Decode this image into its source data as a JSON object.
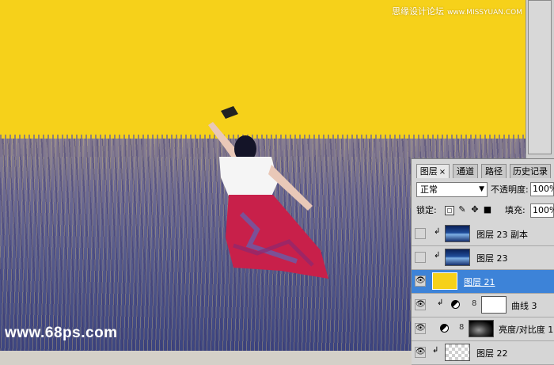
{
  "watermark_top": {
    "text": "思缘设计论坛",
    "site": "www.MISSYUAN.COM"
  },
  "watermark_bottom": "www.68ps.com",
  "colors": {
    "sky": "#f6d11a",
    "selection": "#3d83d8",
    "panel_bg": "#d6d6d6"
  },
  "panel": {
    "tabs": [
      {
        "label": "图层",
        "close": "×"
      },
      {
        "label": "通道"
      },
      {
        "label": "路径"
      },
      {
        "label": "历史记录"
      }
    ],
    "blend_mode": "正常",
    "opacity_label": "不透明度:",
    "opacity_value": "100%",
    "lock_label": "锁定:",
    "fill_label": "填充:",
    "fill_value": "100%",
    "layers": [
      {
        "name": "图层 23 副本",
        "visible": false,
        "thumb": "photo"
      },
      {
        "name": "图层 23",
        "visible": false,
        "thumb": "photo"
      },
      {
        "name": "图层 21",
        "visible": true,
        "selected": true,
        "thumb": "yellow"
      },
      {
        "name": "曲线 3",
        "visible": true,
        "thumb": "white"
      },
      {
        "name": "亮度/对比度 1",
        "visible": true,
        "thumb": "dark"
      },
      {
        "name": "图层 22",
        "visible": true,
        "thumb": "checker"
      }
    ]
  }
}
